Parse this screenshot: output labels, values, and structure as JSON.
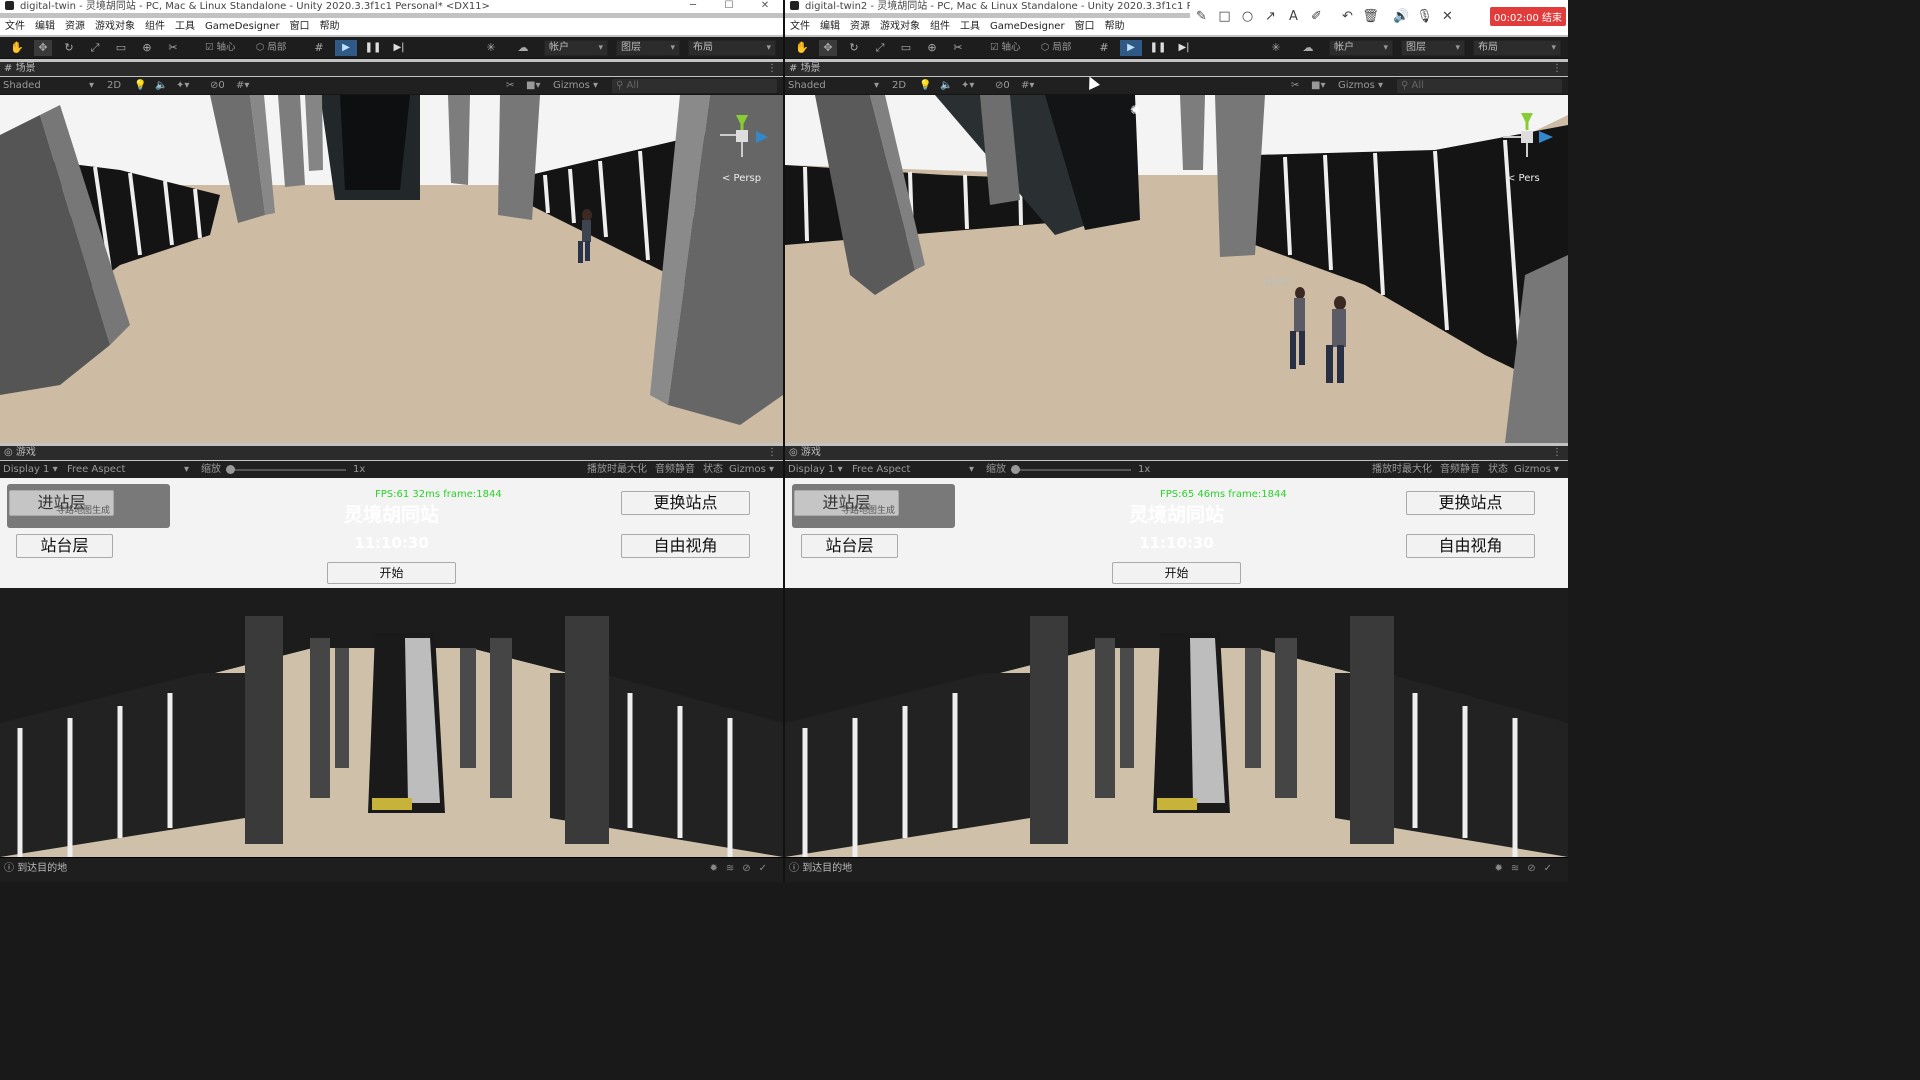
{
  "windows": [
    {
      "title": "digital-twin - 灵境胡同站 - PC, Mac & Linux Standalone - Unity 2020.3.3f1c1 Personal* <DX11>",
      "menu": [
        "文件",
        "编辑",
        "资源",
        "游戏对象",
        "组件",
        "工具",
        "GameDesigner",
        "窗口",
        "帮助"
      ],
      "toolbar": {
        "pivot": "轴心",
        "local": "局部",
        "account": "帐户",
        "layers": "图层",
        "layout": "布局",
        "zero": "0"
      },
      "scene": {
        "tab": "场景",
        "shading": "Shaded",
        "mode2d": "2D",
        "gizmos": "Gizmos",
        "search": "All",
        "persp": "< Persp",
        "zero": "0"
      },
      "game": {
        "tab": "游戏",
        "display": "Display 1",
        "aspect": "Free Aspect",
        "scale_label": "缩放",
        "scale_value": "1x",
        "max_on_play": "播放时最大化",
        "mute": "音频静音",
        "stats": "状态",
        "gizmos": "Gizmos"
      },
      "gui": {
        "fps": "FPS:61  32ms frame:1844",
        "station": "灵境胡同站",
        "time": "11:10:30",
        "concourse": "进站层",
        "hint": "寻路地图生成",
        "platform": "站台层",
        "start": "开始",
        "change_station": "更换站点",
        "free_view": "自由视角"
      },
      "status": "到达目的地"
    },
    {
      "title": "digital-twin2 - 灵境胡同站 - PC, Mac & Linux Standalone - Unity 2020.3.3f1c1 Pers",
      "menu": [
        "文件",
        "编辑",
        "资源",
        "游戏对象",
        "组件",
        "工具",
        "GameDesigner",
        "窗口",
        "帮助"
      ],
      "toolbar": {
        "pivot": "轴心",
        "local": "局部",
        "account": "帐户",
        "layers": "图层",
        "layout": "布局",
        "zero": "0"
      },
      "scene": {
        "tab": "场景",
        "shading": "Shaded",
        "mode2d": "2D",
        "gizmos": "Gizmos",
        "search": "All",
        "persp": "< Pers",
        "zero": "0",
        "label": "静态的"
      },
      "game": {
        "tab": "游戏",
        "display": "Display 1",
        "aspect": "Free Aspect",
        "scale_label": "缩放",
        "scale_value": "1x",
        "max_on_play": "播放时最大化",
        "mute": "音频静音",
        "stats": "状态",
        "gizmos": "Gizmos"
      },
      "gui": {
        "fps": "FPS:65  46ms frame:1844",
        "station": "灵境胡同站",
        "time": "11:10:30",
        "concourse": "进站层",
        "hint": "寻路地图生成",
        "platform": "站台层",
        "start": "开始",
        "change_station": "更换站点",
        "free_view": "自由视角"
      },
      "status": "到达目的地"
    }
  ],
  "recorder": {
    "timer": "00:02:00 结束",
    "icons": [
      "pencil-icon",
      "rectangle-icon",
      "circle-icon",
      "arrow-icon",
      "text-icon",
      "marker-icon",
      "undo-icon",
      "delete-icon",
      "speaker-icon",
      "microphone-icon",
      "close-icon"
    ]
  }
}
